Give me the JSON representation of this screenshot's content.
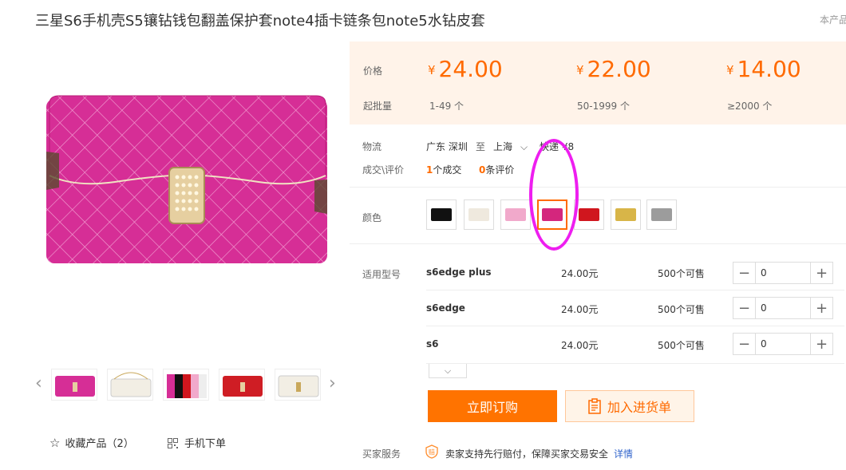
{
  "product": {
    "title": "三星S6手机壳S5镶钻钱包翻盖保护套note4插卡链条包note5水钻皮套",
    "top_link": "本产品"
  },
  "gallery": {
    "prev_arrow": "‹",
    "next_arrow": "›",
    "favorite_label": "收藏产品（2）",
    "mobile_order_label": "手机下单",
    "thumbnails": [
      "rose-clutch",
      "white-chain",
      "multi-color",
      "red-clutch",
      "white-clutch"
    ]
  },
  "pricing": {
    "price_label": "价格",
    "moq_label": "起批量",
    "currency": "¥",
    "tiers": [
      {
        "price": "24.00",
        "range": "1-49 个"
      },
      {
        "price": "22.00",
        "range": "50-1999 个"
      },
      {
        "price": "14.00",
        "range": "≥2000 个"
      }
    ]
  },
  "logistics": {
    "label": "物流",
    "from": "广东 深圳",
    "to_word": "至",
    "to": "上海",
    "shipping": "快递 ¥8"
  },
  "reviews": {
    "label": "成交\\评价",
    "deals_count": "1",
    "deals_text": "个成交",
    "reviews_count": "0",
    "reviews_text": "条评价"
  },
  "color": {
    "label": "颜色",
    "swatches": [
      {
        "name": "black",
        "color": "#111111"
      },
      {
        "name": "white",
        "color": "#efe9de"
      },
      {
        "name": "pink",
        "color": "#f1a9cb"
      },
      {
        "name": "rose",
        "color": "#d4267d"
      },
      {
        "name": "red",
        "color": "#d0161e"
      },
      {
        "name": "gold",
        "color": "#d8b548"
      },
      {
        "name": "silver",
        "color": "#9c9c9c"
      }
    ],
    "selected_index": 3
  },
  "models": {
    "label": "适用型号",
    "rows": [
      {
        "name": "s6edge plus",
        "price": "24.00元",
        "stock": "500个可售",
        "qty": "0"
      },
      {
        "name": "s6edge",
        "price": "24.00元",
        "stock": "500个可售",
        "qty": "0"
      },
      {
        "name": "s6",
        "price": "24.00元",
        "stock": "500个可售",
        "qty": "0"
      }
    ],
    "minus": "−",
    "plus": "+"
  },
  "actions": {
    "buy_now": "立即订购",
    "add_to_cart": "加入进货单"
  },
  "buyer_service": {
    "label": "买家服务",
    "badge": "赔",
    "text": "卖家支持先行赔付，保障买家交易安全",
    "link": "详情"
  },
  "colors": {
    "accent": "#ff6a00",
    "highlight_circle": "#ee1ef0"
  }
}
